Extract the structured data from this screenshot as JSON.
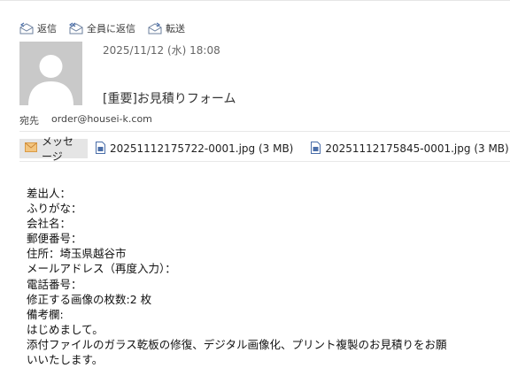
{
  "toolbar": {
    "reply_label": "返信",
    "reply_all_label": "全員に返信",
    "forward_label": "転送"
  },
  "header": {
    "date": "2025/11/12 (水) 18:08",
    "subject": "[重要]お見積りフォーム",
    "to_label": "宛先",
    "to_value": "order@housei-k.com"
  },
  "attachments": {
    "message_tab": "メッセージ",
    "files": [
      "20251112175722-0001.jpg (3 MB)",
      "20251112175845-0001.jpg (3 MB)"
    ]
  },
  "body_lines": [
    "差出人：",
    "ふりがな：",
    "会社名：",
    "郵便番号：",
    "住所：埼玉県越谷市",
    "メールアドレス（再度入力）：",
    "電話番号：",
    "修正する画像の枚数:2 枚",
    "備考欄:",
    "はじめまして。",
    "添付ファイルのガラス乾板の修復、デジタル画像化、プリント複製のお見積りをお願",
    "いいたします。"
  ],
  "colors": {
    "avatar_bg": "#c9c9c9",
    "tab_bg": "#e5e5e5",
    "icon_blue": "#4a6ea9",
    "envelope_orange": "#e8b267"
  }
}
